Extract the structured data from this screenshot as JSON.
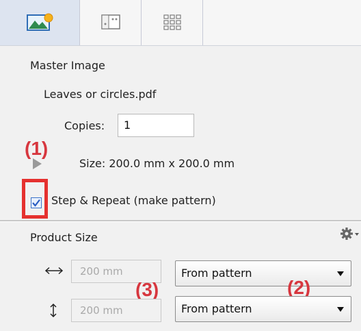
{
  "tabs": [
    {
      "name": "image",
      "icon": "landscape-image-icon",
      "active": true
    },
    {
      "name": "layout",
      "icon": "crop-layout-icon",
      "active": false
    },
    {
      "name": "grid",
      "icon": "grid-icon",
      "active": false
    }
  ],
  "master_image": {
    "title": "Master Image",
    "filename": "Leaves or circles.pdf",
    "copies_label": "Copies:",
    "copies_value": "1",
    "size_text": "Size: 200.0 mm x 200.0 mm",
    "step_repeat_label": "Step & Repeat (make pattern)",
    "step_repeat_checked": true
  },
  "product_size": {
    "title": "Product Size",
    "width_value": "200 mm",
    "height_value": "200 mm",
    "width_mode": "From pattern",
    "height_mode": "From pattern"
  },
  "annotations": {
    "a1": "(1)",
    "a2": "(2)",
    "a3": "(3)"
  },
  "colors": {
    "annotation": "#d7373f",
    "active_tab": "#dde4f0",
    "checkbox_accent": "#2c5fc2"
  }
}
